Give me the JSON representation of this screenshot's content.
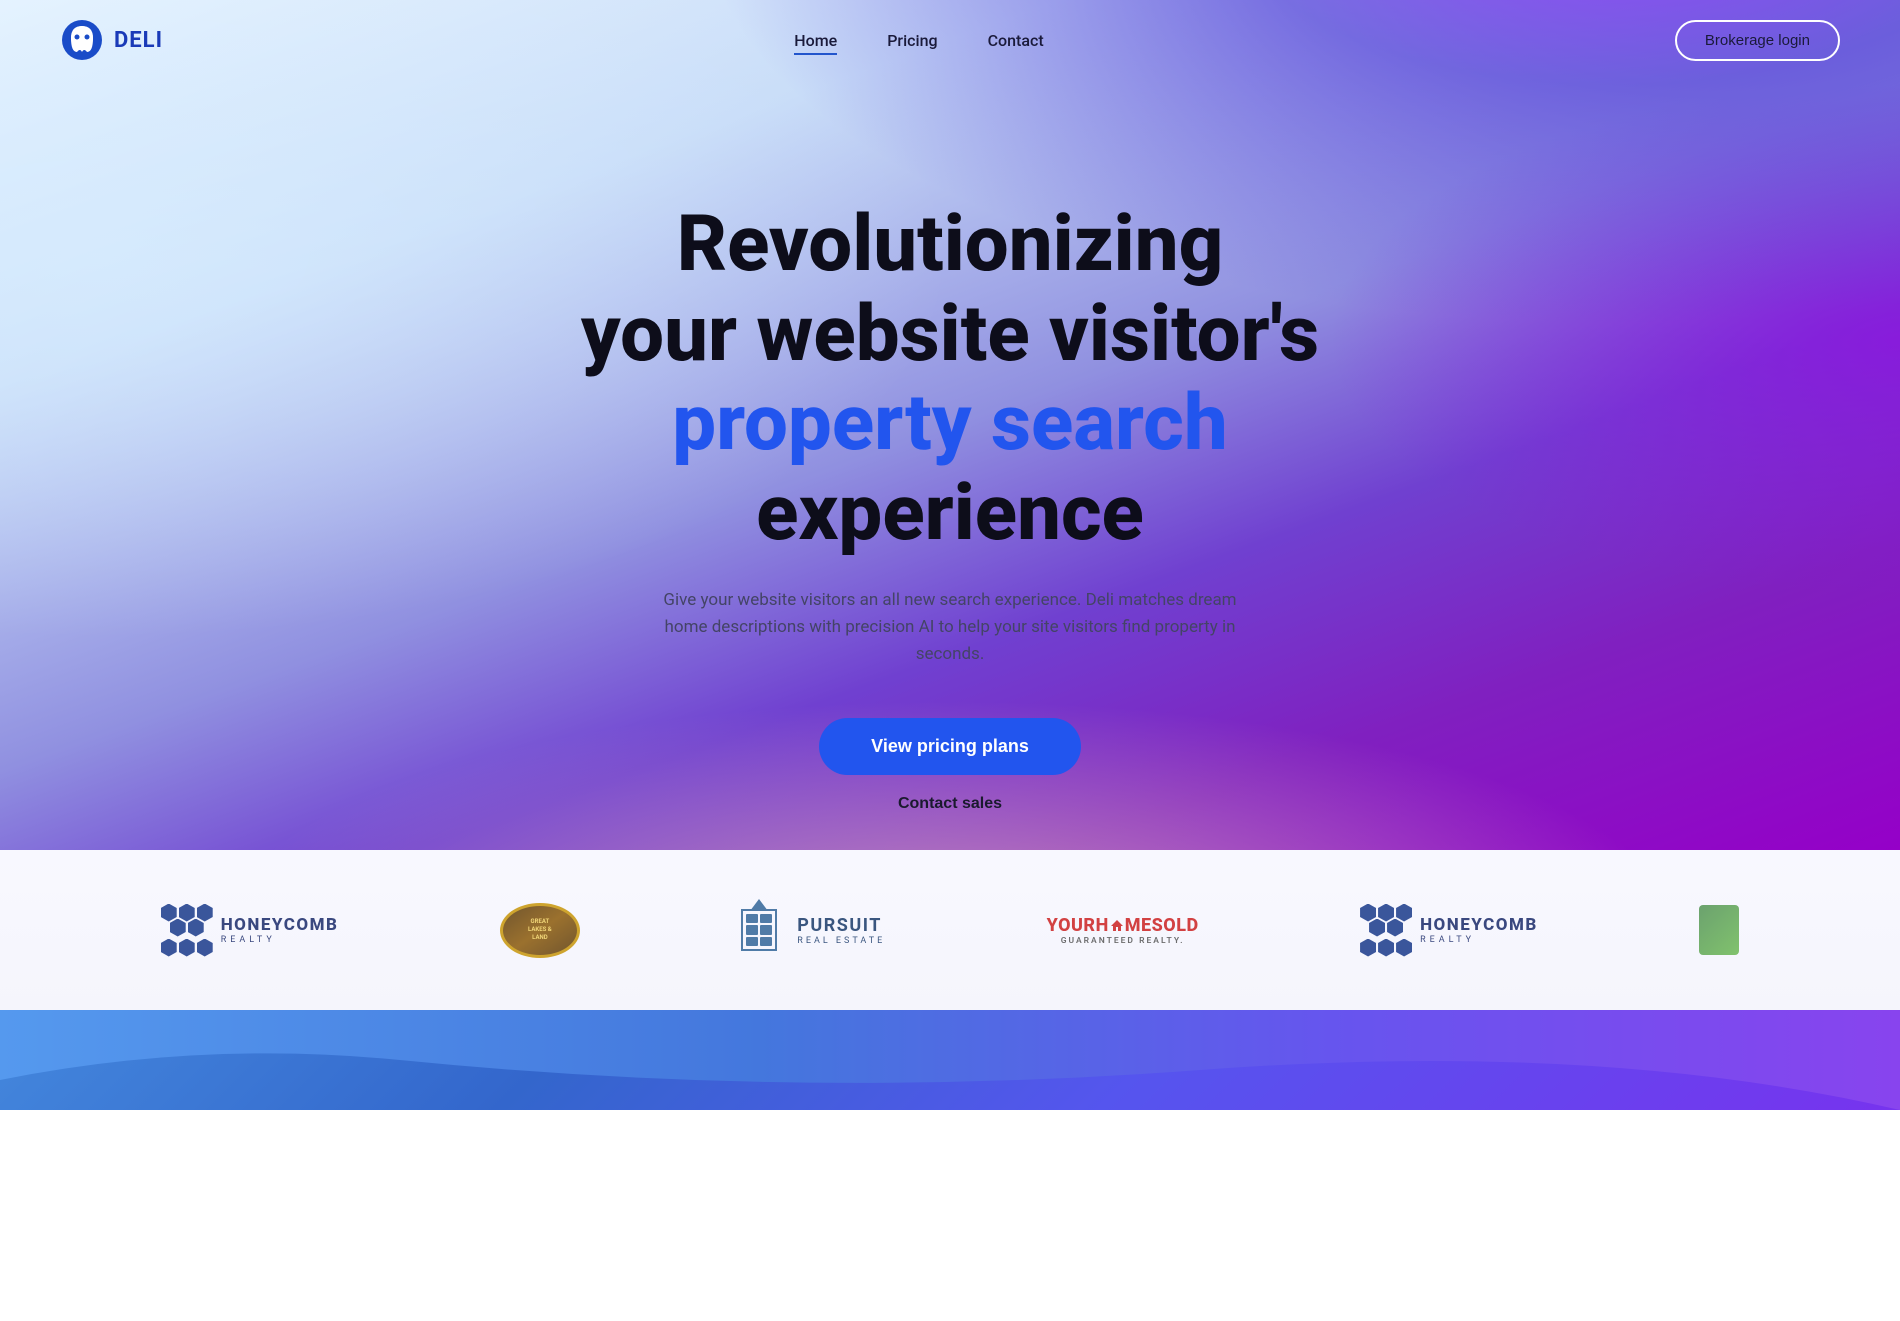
{
  "logo": {
    "text": "DELi",
    "alt": "Deli logo"
  },
  "navbar": {
    "links": [
      {
        "label": "Home",
        "active": true
      },
      {
        "label": "Pricing",
        "active": false
      },
      {
        "label": "Contact",
        "active": false
      }
    ],
    "brokerage_login": "Brokerage login"
  },
  "hero": {
    "title_line1": "Revolutionizing",
    "title_line2": "your website visitor's",
    "title_highlight": "property search",
    "title_end": "experience",
    "subtitle": "Give your website visitors an all new search experience. Deli matches dream home descriptions with precision AI to help your site visitors find property in seconds.",
    "cta_primary": "View pricing plans",
    "cta_secondary": "Contact sales"
  },
  "logos": [
    {
      "name": "honeycomb-realty-1",
      "label": "HONEYCOMB REALTY"
    },
    {
      "name": "great-lakes-land",
      "label": "GREAT LAKES & LAND"
    },
    {
      "name": "pursuit-real-estate",
      "label": "PURSUIT REAL ESTATE"
    },
    {
      "name": "yourhomesold",
      "label": "YOURHOMESOLD GUARANTEED REALTY"
    },
    {
      "name": "honeycomb-realty-2",
      "label": "HONEYCOMB REALTY"
    },
    {
      "name": "partial-logo",
      "label": "Partial logo"
    }
  ]
}
